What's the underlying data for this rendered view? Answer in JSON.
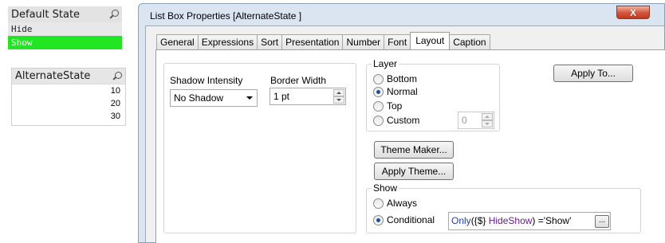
{
  "sheet": {
    "listbox_default_state": {
      "title": "Default State",
      "items": [
        {
          "label": "Hide",
          "state": "optional"
        },
        {
          "label": "Show",
          "state": "selected"
        }
      ]
    },
    "listbox_alternate_state": {
      "title": "AlternateState",
      "items": [
        "10",
        "20",
        "30"
      ]
    }
  },
  "dialog": {
    "title": "List Box Properties [AlternateState ]",
    "close_symbol": "X",
    "tabs": [
      "General",
      "Expressions",
      "Sort",
      "Presentation",
      "Number",
      "Font",
      "Layout",
      "Caption"
    ],
    "active_tab": "Layout",
    "shadow_intensity": {
      "label": "Shadow Intensity",
      "value": "No Shadow"
    },
    "border_width": {
      "label": "Border Width",
      "value": "1 pt"
    },
    "layer": {
      "legend": "Layer",
      "options": [
        "Bottom",
        "Normal",
        "Top",
        "Custom"
      ],
      "selected": "Normal",
      "custom_value": "0"
    },
    "apply_to_label": "Apply To...",
    "theme_maker_label": "Theme Maker...",
    "apply_theme_label": "Apply Theme...",
    "show": {
      "legend": "Show",
      "options": [
        "Always",
        "Conditional"
      ],
      "selected": "Conditional",
      "condition": {
        "fn": "Only",
        "open": "({$} ",
        "field": "HideShow",
        "rest": ") ='Show'"
      },
      "ellipsis_label": "..."
    }
  },
  "colors": {
    "selected_green": "#22e622",
    "caption_gray": "#e3e3e3",
    "close_red": "#c03a22"
  }
}
